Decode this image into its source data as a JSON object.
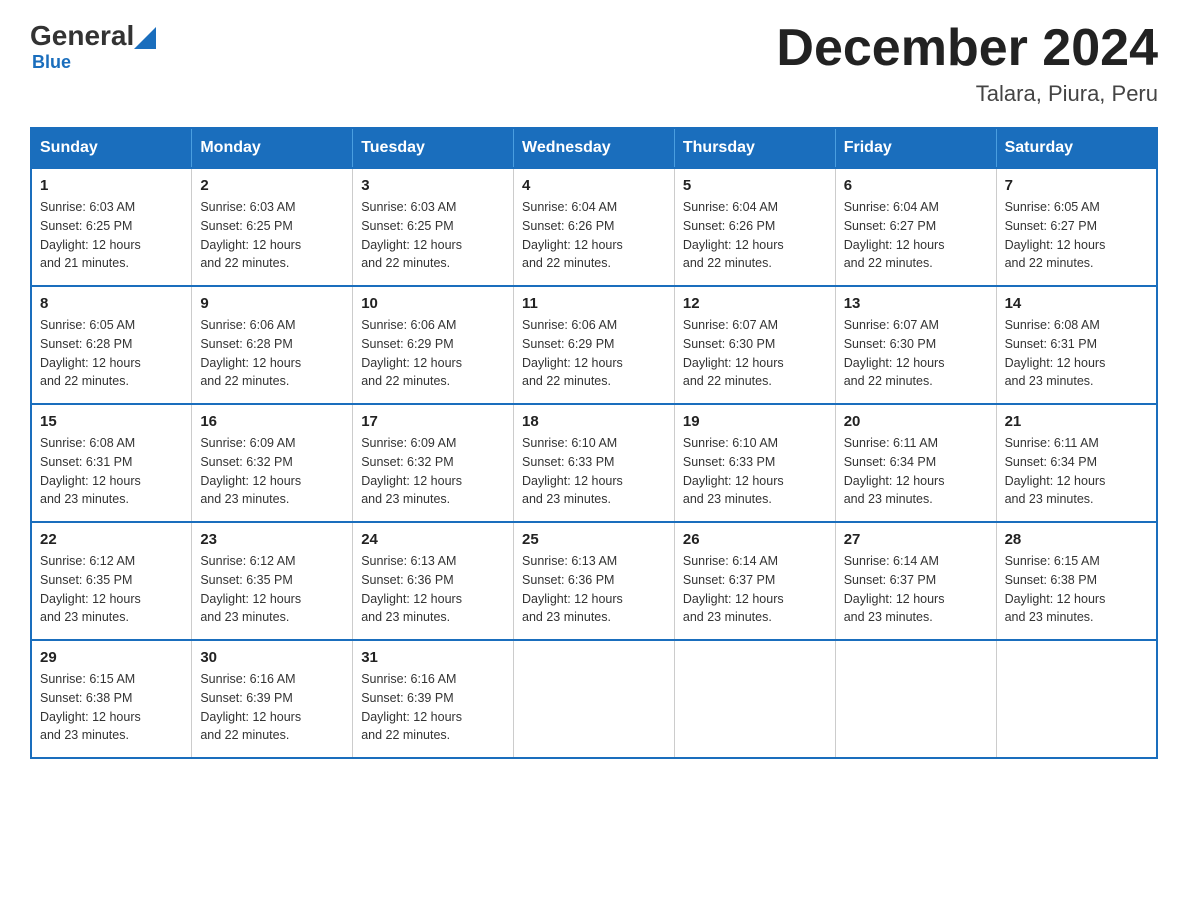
{
  "header": {
    "logo": {
      "general": "General",
      "blue": "Blue",
      "triangle": "▲"
    },
    "title": "December 2024",
    "location": "Talara, Piura, Peru"
  },
  "calendar": {
    "headers": [
      "Sunday",
      "Monday",
      "Tuesday",
      "Wednesday",
      "Thursday",
      "Friday",
      "Saturday"
    ],
    "weeks": [
      [
        {
          "day": "1",
          "sunrise": "6:03 AM",
          "sunset": "6:25 PM",
          "daylight": "12 hours and 21 minutes."
        },
        {
          "day": "2",
          "sunrise": "6:03 AM",
          "sunset": "6:25 PM",
          "daylight": "12 hours and 22 minutes."
        },
        {
          "day": "3",
          "sunrise": "6:03 AM",
          "sunset": "6:25 PM",
          "daylight": "12 hours and 22 minutes."
        },
        {
          "day": "4",
          "sunrise": "6:04 AM",
          "sunset": "6:26 PM",
          "daylight": "12 hours and 22 minutes."
        },
        {
          "day": "5",
          "sunrise": "6:04 AM",
          "sunset": "6:26 PM",
          "daylight": "12 hours and 22 minutes."
        },
        {
          "day": "6",
          "sunrise": "6:04 AM",
          "sunset": "6:27 PM",
          "daylight": "12 hours and 22 minutes."
        },
        {
          "day": "7",
          "sunrise": "6:05 AM",
          "sunset": "6:27 PM",
          "daylight": "12 hours and 22 minutes."
        }
      ],
      [
        {
          "day": "8",
          "sunrise": "6:05 AM",
          "sunset": "6:28 PM",
          "daylight": "12 hours and 22 minutes."
        },
        {
          "day": "9",
          "sunrise": "6:06 AM",
          "sunset": "6:28 PM",
          "daylight": "12 hours and 22 minutes."
        },
        {
          "day": "10",
          "sunrise": "6:06 AM",
          "sunset": "6:29 PM",
          "daylight": "12 hours and 22 minutes."
        },
        {
          "day": "11",
          "sunrise": "6:06 AM",
          "sunset": "6:29 PM",
          "daylight": "12 hours and 22 minutes."
        },
        {
          "day": "12",
          "sunrise": "6:07 AM",
          "sunset": "6:30 PM",
          "daylight": "12 hours and 22 minutes."
        },
        {
          "day": "13",
          "sunrise": "6:07 AM",
          "sunset": "6:30 PM",
          "daylight": "12 hours and 22 minutes."
        },
        {
          "day": "14",
          "sunrise": "6:08 AM",
          "sunset": "6:31 PM",
          "daylight": "12 hours and 23 minutes."
        }
      ],
      [
        {
          "day": "15",
          "sunrise": "6:08 AM",
          "sunset": "6:31 PM",
          "daylight": "12 hours and 23 minutes."
        },
        {
          "day": "16",
          "sunrise": "6:09 AM",
          "sunset": "6:32 PM",
          "daylight": "12 hours and 23 minutes."
        },
        {
          "day": "17",
          "sunrise": "6:09 AM",
          "sunset": "6:32 PM",
          "daylight": "12 hours and 23 minutes."
        },
        {
          "day": "18",
          "sunrise": "6:10 AM",
          "sunset": "6:33 PM",
          "daylight": "12 hours and 23 minutes."
        },
        {
          "day": "19",
          "sunrise": "6:10 AM",
          "sunset": "6:33 PM",
          "daylight": "12 hours and 23 minutes."
        },
        {
          "day": "20",
          "sunrise": "6:11 AM",
          "sunset": "6:34 PM",
          "daylight": "12 hours and 23 minutes."
        },
        {
          "day": "21",
          "sunrise": "6:11 AM",
          "sunset": "6:34 PM",
          "daylight": "12 hours and 23 minutes."
        }
      ],
      [
        {
          "day": "22",
          "sunrise": "6:12 AM",
          "sunset": "6:35 PM",
          "daylight": "12 hours and 23 minutes."
        },
        {
          "day": "23",
          "sunrise": "6:12 AM",
          "sunset": "6:35 PM",
          "daylight": "12 hours and 23 minutes."
        },
        {
          "day": "24",
          "sunrise": "6:13 AM",
          "sunset": "6:36 PM",
          "daylight": "12 hours and 23 minutes."
        },
        {
          "day": "25",
          "sunrise": "6:13 AM",
          "sunset": "6:36 PM",
          "daylight": "12 hours and 23 minutes."
        },
        {
          "day": "26",
          "sunrise": "6:14 AM",
          "sunset": "6:37 PM",
          "daylight": "12 hours and 23 minutes."
        },
        {
          "day": "27",
          "sunrise": "6:14 AM",
          "sunset": "6:37 PM",
          "daylight": "12 hours and 23 minutes."
        },
        {
          "day": "28",
          "sunrise": "6:15 AM",
          "sunset": "6:38 PM",
          "daylight": "12 hours and 23 minutes."
        }
      ],
      [
        {
          "day": "29",
          "sunrise": "6:15 AM",
          "sunset": "6:38 PM",
          "daylight": "12 hours and 23 minutes."
        },
        {
          "day": "30",
          "sunrise": "6:16 AM",
          "sunset": "6:39 PM",
          "daylight": "12 hours and 22 minutes."
        },
        {
          "day": "31",
          "sunrise": "6:16 AM",
          "sunset": "6:39 PM",
          "daylight": "12 hours and 22 minutes."
        },
        null,
        null,
        null,
        null
      ]
    ],
    "labels": {
      "sunrise": "Sunrise:",
      "sunset": "Sunset:",
      "daylight": "Daylight:"
    }
  }
}
